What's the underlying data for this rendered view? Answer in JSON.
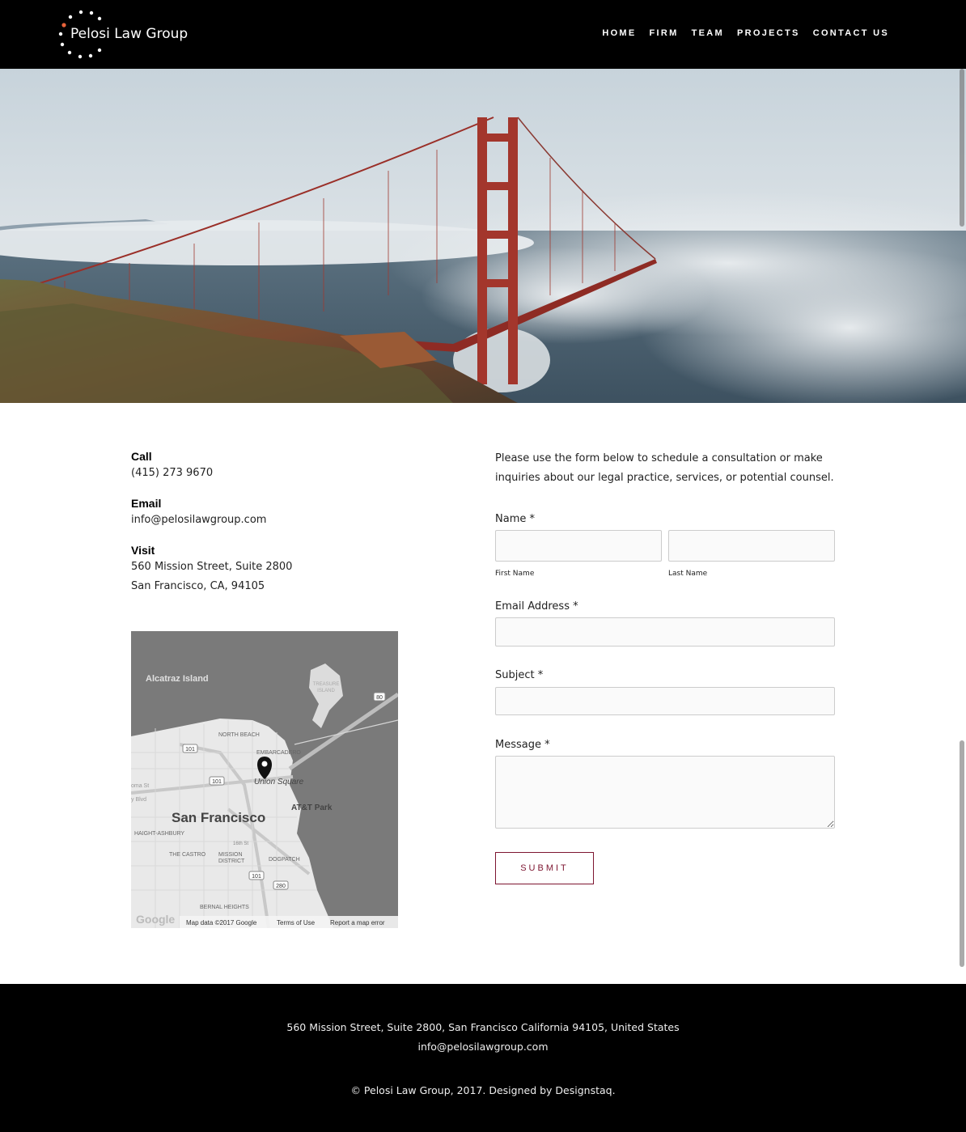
{
  "brand": {
    "name": "Pelosi Law Group",
    "accent_color": "#e8623a",
    "primary_button_color": "#7d1530"
  },
  "nav": {
    "items": [
      {
        "label": "HOME"
      },
      {
        "label": "FIRM"
      },
      {
        "label": "TEAM"
      },
      {
        "label": "PROJECTS"
      },
      {
        "label": "CONTACT US"
      }
    ]
  },
  "hero": {
    "image_icon": "golden-gate-bridge-photo"
  },
  "contact": {
    "call": {
      "heading": "Call",
      "value": "(415) 273 9670"
    },
    "email": {
      "heading": "Email",
      "value": "info@pelosilawgroup.com"
    },
    "visit": {
      "heading": "Visit",
      "line1": "560 Mission Street, Suite 2800",
      "line2": "San Francisco, CA, 94105"
    }
  },
  "map": {
    "labels": {
      "alcatraz": "Alcatraz Island",
      "treasure1": "TREASURE",
      "treasure2": "ISLAND",
      "north_beach": "NORTH BEACH",
      "embarcadero": "EMBARCADERO",
      "union_square": "Union Square",
      "att_park": "AT&T Park",
      "city": "San Francisco",
      "haight": "HAIGHT-ASHBURY",
      "castro": "THE CASTRO",
      "mission1": "MISSION",
      "mission2": "DISTRICT",
      "dogpatch": "DOGPATCH",
      "bernal": "BERNAL HEIGHTS",
      "street_16th": "16th St",
      "road_101a": "101",
      "road_101b": "101",
      "road_101c": "101",
      "road_80": "80",
      "road_280": "280",
      "partial_soma": "oma St",
      "partial_blvd": "y Blvd"
    },
    "footer": {
      "google": "Google",
      "map_data": "Map data ©2017 Google",
      "terms": "Terms of Use",
      "report": "Report a map error"
    }
  },
  "form": {
    "intro": "Please use the form below to schedule a consultation or make inquiries about our legal practice, services, or potential counsel.",
    "name_label": "Name *",
    "first_name_label": "First Name",
    "last_name_label": "Last Name",
    "email_label": "Email Address *",
    "subject_label": "Subject *",
    "message_label": "Message *",
    "first_name_value": "",
    "last_name_value": "",
    "email_value": "",
    "subject_value": "",
    "message_value": "",
    "submit_label": "SUBMIT"
  },
  "footer": {
    "address": "560 Mission Street, Suite 2800, San Francisco California 94105, United States",
    "email": "info@pelosilawgroup.com",
    "copyright": "© Pelosi Law Group, 2017. Designed by Designstaq."
  }
}
